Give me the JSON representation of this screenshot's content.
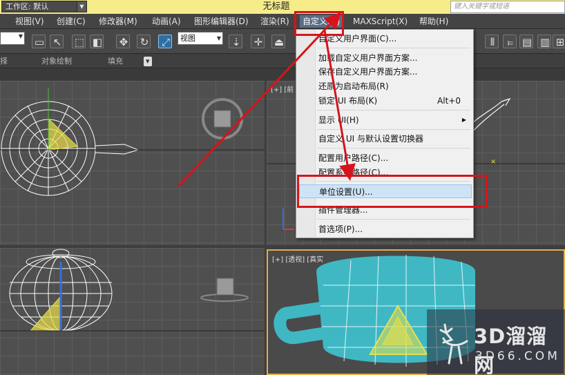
{
  "title_bar": {
    "workspace": "工作区: 默认",
    "doc_title": "无标题",
    "search_placeholder": "键入关键字或短语"
  },
  "menubar": {
    "items": [
      "视图(V)",
      "创建(C)",
      "修改器(M)",
      "动画(A)",
      "图形编辑器(D)",
      "渲染(R)",
      "自定义(U)",
      "MAXScript(X)",
      "帮助(H)"
    ],
    "active_index": 6
  },
  "toolbar": {
    "view_dropdown": "视图",
    "left_dropdown": ""
  },
  "ribbon": {
    "labels": [
      "择",
      "对象绘制",
      "填充"
    ]
  },
  "viewports": {
    "front_label": "[+] [前",
    "persp_label": "[+] [透视] [真实"
  },
  "dropdown": {
    "items": [
      {
        "label": "自定义用户界面(C)...",
        "shortcut": "",
        "submenu": false
      },
      {
        "label": "加载自定义用户界面方案...",
        "shortcut": "",
        "submenu": false
      },
      {
        "label": "保存自定义用户界面方案...",
        "shortcut": "",
        "submenu": false
      },
      {
        "label": "还原为启动布局(R)",
        "shortcut": "",
        "submenu": false
      },
      {
        "label": "锁定 UI 布局(K)",
        "shortcut": "Alt+0",
        "submenu": false
      },
      {
        "label": "显示 UI(H)",
        "shortcut": "",
        "submenu": true
      },
      {
        "label": "自定义 UI 与默认设置切换器",
        "shortcut": "",
        "submenu": false
      },
      {
        "label": "配置用户路径(C)...",
        "shortcut": "",
        "submenu": false
      },
      {
        "label": "配置系统路径(C)...",
        "shortcut": "",
        "submenu": false
      },
      {
        "label": "单位设置(U)...",
        "shortcut": "",
        "submenu": false
      },
      {
        "label": "插件管理器...",
        "shortcut": "",
        "submenu": false
      },
      {
        "label": "首选项(P)...",
        "shortcut": "",
        "submenu": false
      }
    ],
    "highlighted_index": 9
  },
  "watermark": {
    "main": "3D溜溜网",
    "sub": "3D66.COM"
  },
  "colors": {
    "title_bar": "#f6ec8a",
    "annotation_red": "#d6141b",
    "menu_highlight": "#cde3f6",
    "persp_border": "#e3b04a",
    "teapot_wire": "#ffffff",
    "teapot_fill": "#3fb8c4",
    "gizmo_yellow": "#e8e04a"
  }
}
